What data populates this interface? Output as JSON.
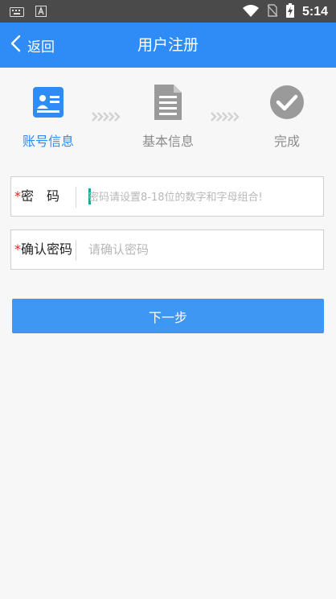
{
  "status_bar": {
    "time": "5:14",
    "icons": [
      "keyboard-icon",
      "a-badge-icon",
      "wifi-icon",
      "no-sim-icon",
      "battery-charging-icon"
    ]
  },
  "header": {
    "back_label": "返回",
    "title": "用户注册"
  },
  "steps": [
    {
      "label": "账号信息",
      "icon": "id-card-icon",
      "active": true
    },
    {
      "label": "基本信息",
      "icon": "document-icon",
      "active": false
    },
    {
      "label": "完成",
      "icon": "check-circle-icon",
      "active": false
    }
  ],
  "form": {
    "password": {
      "required_mark": "*",
      "label": "密　码",
      "value": "",
      "placeholder": "密码请设置8-18位的数字和字母组合!"
    },
    "confirm_password": {
      "required_mark": "*",
      "label": "确认密码",
      "value": "",
      "placeholder": "请确认密码"
    }
  },
  "next_button": {
    "label": "下一步"
  },
  "colors": {
    "primary": "#2f8bf5",
    "button": "#3d97f3",
    "required": "#e02020",
    "inactive": "#8c8c8c"
  }
}
